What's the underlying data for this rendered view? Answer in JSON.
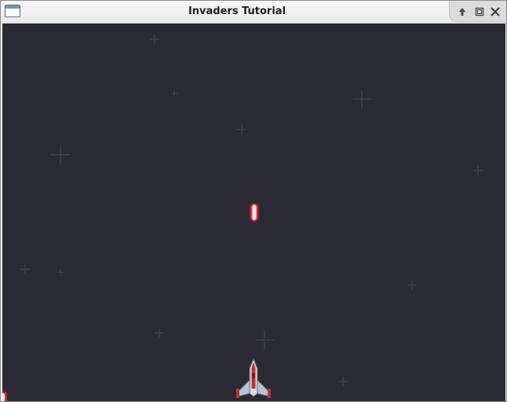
{
  "window": {
    "title": "Invaders Tutorial",
    "icon": "window-app-icon",
    "controls": [
      "shade-icon",
      "maximize-icon",
      "close-icon"
    ]
  },
  "game": {
    "background_color": "#2a2b32",
    "entities": [
      "player-ship",
      "player-laser-bolt",
      "edge-sprite"
    ],
    "player_ship_colors": {
      "hull": "#d7dde6",
      "accent": "#c0303a",
      "flame": "#f2b01e"
    },
    "laser_color": "#d8424a"
  }
}
